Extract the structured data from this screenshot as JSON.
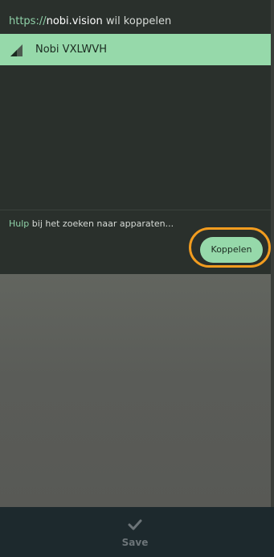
{
  "dialog": {
    "origin_scheme": "https://",
    "origin_host": "nobi.vision",
    "header_suffix": " wil koppelen",
    "devices": [
      {
        "name": "Nobi VXLWVH",
        "icon": "signal-strength-icon",
        "selected": true
      }
    ],
    "help_link": "Hulp",
    "help_rest": " bij het zoeken naar apparaten...",
    "pair_button_label": "Koppelen"
  },
  "bottom_bar": {
    "save_label": "Save",
    "save_icon": "checkmark-icon"
  },
  "colors": {
    "accent": "#96d9aa",
    "highlight_ring": "#f29c1f",
    "dialog_bg": "#2a302c",
    "backdrop": "#5a5c58",
    "bottom_bar": "#1d292d"
  }
}
